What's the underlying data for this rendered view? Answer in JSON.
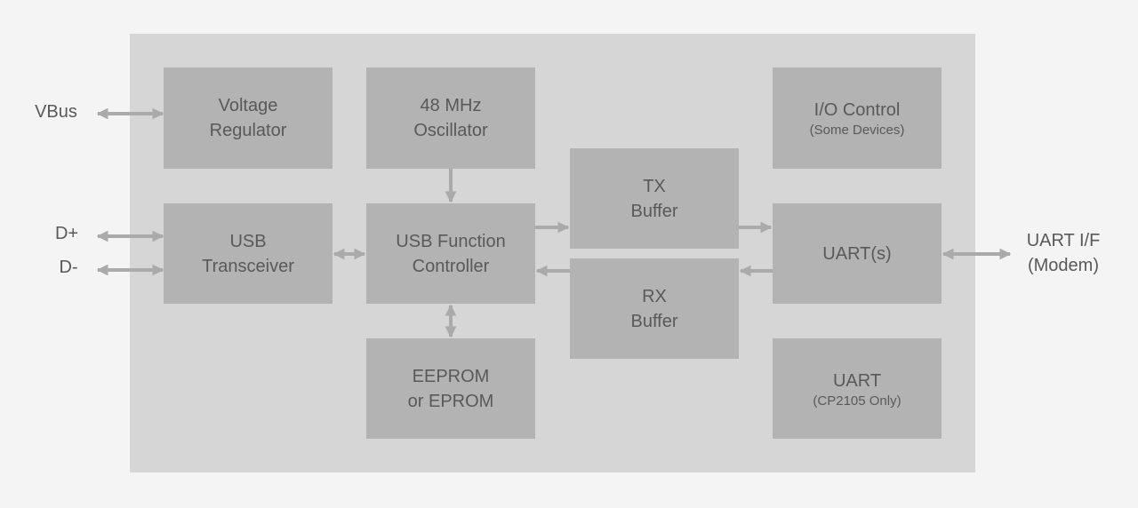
{
  "colors": {
    "background": "#f4f4f4",
    "chip": "#d6d6d6",
    "block": "#b3b3b3",
    "arrow": "#aaaaaa",
    "text": "#595959"
  },
  "external": {
    "vbus": "VBus",
    "dplus": "D+",
    "dminus": "D-",
    "uart_if_line1": "UART I/F",
    "uart_if_line2": "(Modem)"
  },
  "blocks": {
    "voltage_regulator": {
      "line1": "Voltage",
      "line2": "Regulator"
    },
    "oscillator": {
      "line1": "48 MHz",
      "line2": "Oscillator"
    },
    "io_control": {
      "line1": "I/O Control",
      "sub": "(Some Devices)"
    },
    "tx_buffer": {
      "line1": "TX",
      "line2": "Buffer"
    },
    "rx_buffer": {
      "line1": "RX",
      "line2": "Buffer"
    },
    "usb_transceiver": {
      "line1": "USB",
      "line2": "Transceiver"
    },
    "usb_function_controller": {
      "line1": "USB Function",
      "line2": "Controller"
    },
    "uarts": {
      "line1": "UART(s)"
    },
    "eeprom": {
      "line1": "EEPROM",
      "line2": "or EPROM"
    },
    "uart_cp2105": {
      "line1": "UART",
      "sub": "(CP2105 Only)"
    }
  }
}
